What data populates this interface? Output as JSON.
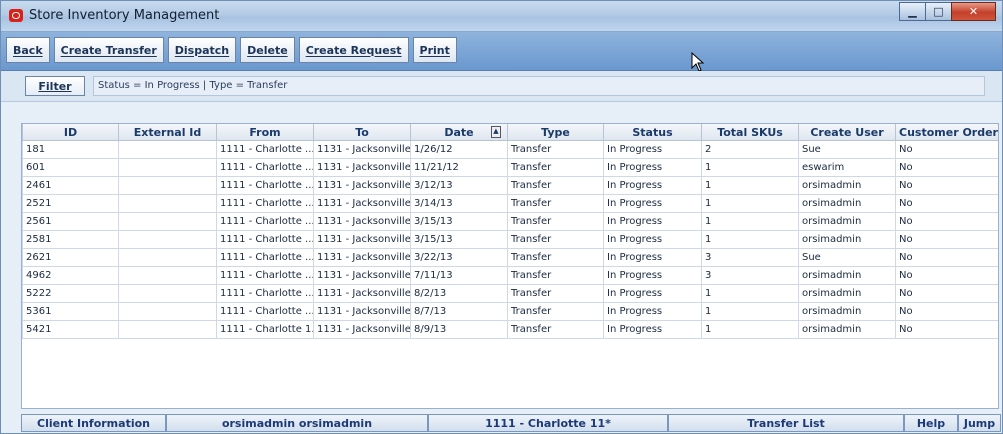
{
  "window": {
    "title": "Store Inventory Management",
    "controls": {
      "minimize": "▁",
      "maximize": "□",
      "close": "✕"
    }
  },
  "toolbar": {
    "buttons": [
      "Back",
      "Create Transfer",
      "Dispatch",
      "Delete",
      "Create Request",
      "Print"
    ]
  },
  "filter": {
    "button_label": "Filter",
    "text": "Status = In Progress | Type = Transfer"
  },
  "table": {
    "columns": [
      "ID",
      "External Id",
      "From",
      "To",
      "Date",
      "Type",
      "Status",
      "Total SKUs",
      "Create User",
      "Customer Order"
    ],
    "rows": [
      [
        "181",
        "",
        "1111 - Charlotte ...",
        "1131 - Jacksonville",
        "1/26/12",
        "Transfer",
        "In Progress",
        "2",
        "Sue",
        "No"
      ],
      [
        "601",
        "",
        "1111 - Charlotte ...",
        "1131 - Jacksonville",
        "11/21/12",
        "Transfer",
        "In Progress",
        "1",
        "eswarim",
        "No"
      ],
      [
        "2461",
        "",
        "1111 - Charlotte ...",
        "1131 - Jacksonville",
        "3/12/13",
        "Transfer",
        "In Progress",
        "1",
        "orsimadmin",
        "No"
      ],
      [
        "2521",
        "",
        "1111 - Charlotte ...",
        "1131 - Jacksonville",
        "3/14/13",
        "Transfer",
        "In Progress",
        "1",
        "orsimadmin",
        "No"
      ],
      [
        "2561",
        "",
        "1111 - Charlotte ...",
        "1131 - Jacksonville",
        "3/15/13",
        "Transfer",
        "In Progress",
        "1",
        "orsimadmin",
        "No"
      ],
      [
        "2581",
        "",
        "1111 - Charlotte ...",
        "1131 - Jacksonville",
        "3/15/13",
        "Transfer",
        "In Progress",
        "1",
        "orsimadmin",
        "No"
      ],
      [
        "2621",
        "",
        "1111 - Charlotte ...",
        "1131 - Jacksonville",
        "3/22/13",
        "Transfer",
        "In Progress",
        "3",
        "Sue",
        "No"
      ],
      [
        "4962",
        "",
        "1111 - Charlotte ...",
        "1131 - Jacksonville",
        "7/11/13",
        "Transfer",
        "In Progress",
        "3",
        "orsimadmin",
        "No"
      ],
      [
        "5222",
        "",
        "1111 - Charlotte ...",
        "1131 - Jacksonville",
        "8/2/13",
        "Transfer",
        "In Progress",
        "1",
        "orsimadmin",
        "No"
      ],
      [
        "5361",
        "",
        "1111 - Charlotte ...",
        "1131 - Jacksonville",
        "8/7/13",
        "Transfer",
        "In Progress",
        "1",
        "orsimadmin",
        "No"
      ],
      [
        "5421",
        "",
        "1111 - Charlotte 1...",
        "1131 - Jacksonville",
        "8/9/13",
        "Transfer",
        "In Progress",
        "1",
        "orsimadmin",
        "No"
      ]
    ]
  },
  "statusbar": {
    "client_info": "Client Information",
    "user": "orsimadmin orsimadmin",
    "store": "1111 - Charlotte 11*",
    "screen": "Transfer List",
    "help": "Help",
    "jump": "Jump"
  },
  "colors": {
    "title_bar": "#b3cbe6",
    "toolbar": "#7aa5d6",
    "close_button": "#c4402a",
    "header_text": "#1a3a6a"
  }
}
